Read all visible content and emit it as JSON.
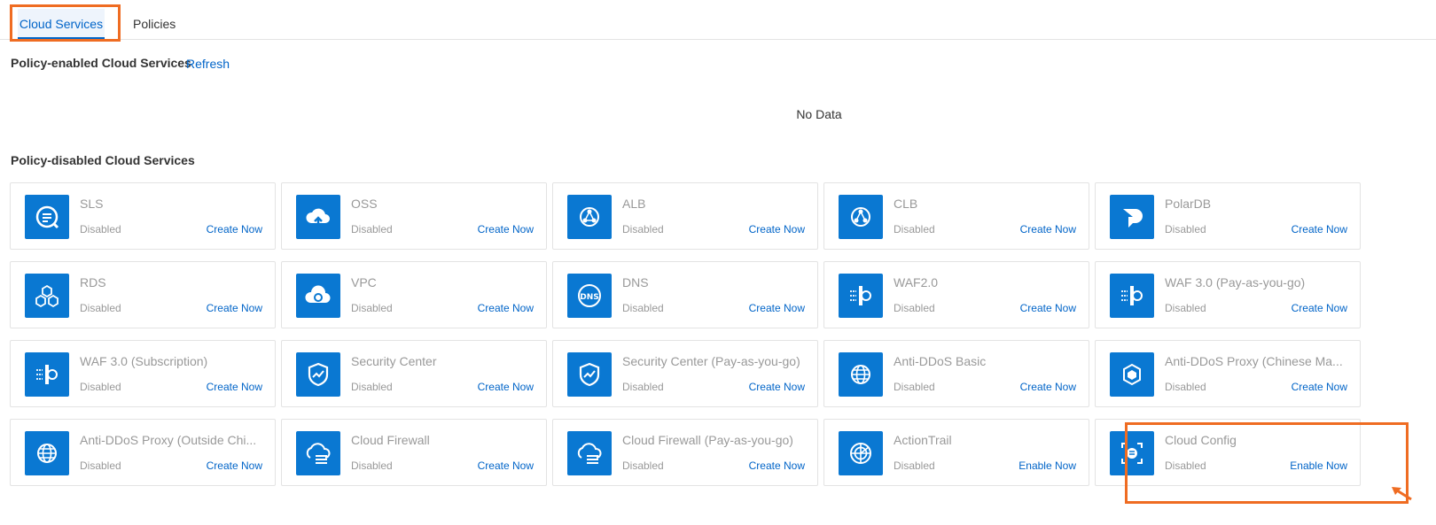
{
  "tabs": [
    {
      "label": "Cloud Services",
      "active": true
    },
    {
      "label": "Policies",
      "active": false
    }
  ],
  "enabled_section": {
    "title": "Policy-enabled Cloud Services",
    "refresh_label": "Refresh",
    "empty_text": "No Data"
  },
  "disabled_section": {
    "title": "Policy-disabled Cloud Services"
  },
  "accent_color": "#0064c8",
  "icon_bg_color": "#0a78d2",
  "highlight_color": "#ef6c22",
  "services": [
    {
      "name": "SLS",
      "status": "Disabled",
      "action": "Create Now",
      "icon": "sls-icon"
    },
    {
      "name": "OSS",
      "status": "Disabled",
      "action": "Create Now",
      "icon": "oss-icon"
    },
    {
      "name": "ALB",
      "status": "Disabled",
      "action": "Create Now",
      "icon": "alb-icon"
    },
    {
      "name": "CLB",
      "status": "Disabled",
      "action": "Create Now",
      "icon": "clb-icon"
    },
    {
      "name": "PolarDB",
      "status": "Disabled",
      "action": "Create Now",
      "icon": "polardb-icon"
    },
    {
      "name": "RDS",
      "status": "Disabled",
      "action": "Create Now",
      "icon": "rds-icon"
    },
    {
      "name": "VPC",
      "status": "Disabled",
      "action": "Create Now",
      "icon": "vpc-icon"
    },
    {
      "name": "DNS",
      "status": "Disabled",
      "action": "Create Now",
      "icon": "dns-icon"
    },
    {
      "name": "WAF2.0",
      "status": "Disabled",
      "action": "Create Now",
      "icon": "waf-icon"
    },
    {
      "name": "WAF 3.0 (Pay-as-you-go)",
      "status": "Disabled",
      "action": "Create Now",
      "icon": "waf-icon"
    },
    {
      "name": "WAF 3.0 (Subscription)",
      "status": "Disabled",
      "action": "Create Now",
      "icon": "waf-icon"
    },
    {
      "name": "Security Center",
      "status": "Disabled",
      "action": "Create Now",
      "icon": "shield-icon"
    },
    {
      "name": "Security Center (Pay-as-you-go)",
      "status": "Disabled",
      "action": "Create Now",
      "icon": "shield-icon"
    },
    {
      "name": "Anti-DDoS Basic",
      "status": "Disabled",
      "action": "Create Now",
      "icon": "globe-icon"
    },
    {
      "name": "Anti-DDoS Proxy (Chinese Ma...",
      "status": "Disabled",
      "action": "Create Now",
      "icon": "cube-icon"
    },
    {
      "name": "Anti-DDoS Proxy (Outside Chi...",
      "status": "Disabled",
      "action": "Create Now",
      "icon": "globe-icon"
    },
    {
      "name": "Cloud Firewall",
      "status": "Disabled",
      "action": "Create Now",
      "icon": "firewall-icon"
    },
    {
      "name": "Cloud Firewall (Pay-as-you-go)",
      "status": "Disabled",
      "action": "Create Now",
      "icon": "firewall-icon"
    },
    {
      "name": "ActionTrail",
      "status": "Disabled",
      "action": "Enable Now",
      "icon": "radar-icon"
    },
    {
      "name": "Cloud Config",
      "status": "Disabled",
      "action": "Enable Now",
      "icon": "config-icon"
    }
  ]
}
